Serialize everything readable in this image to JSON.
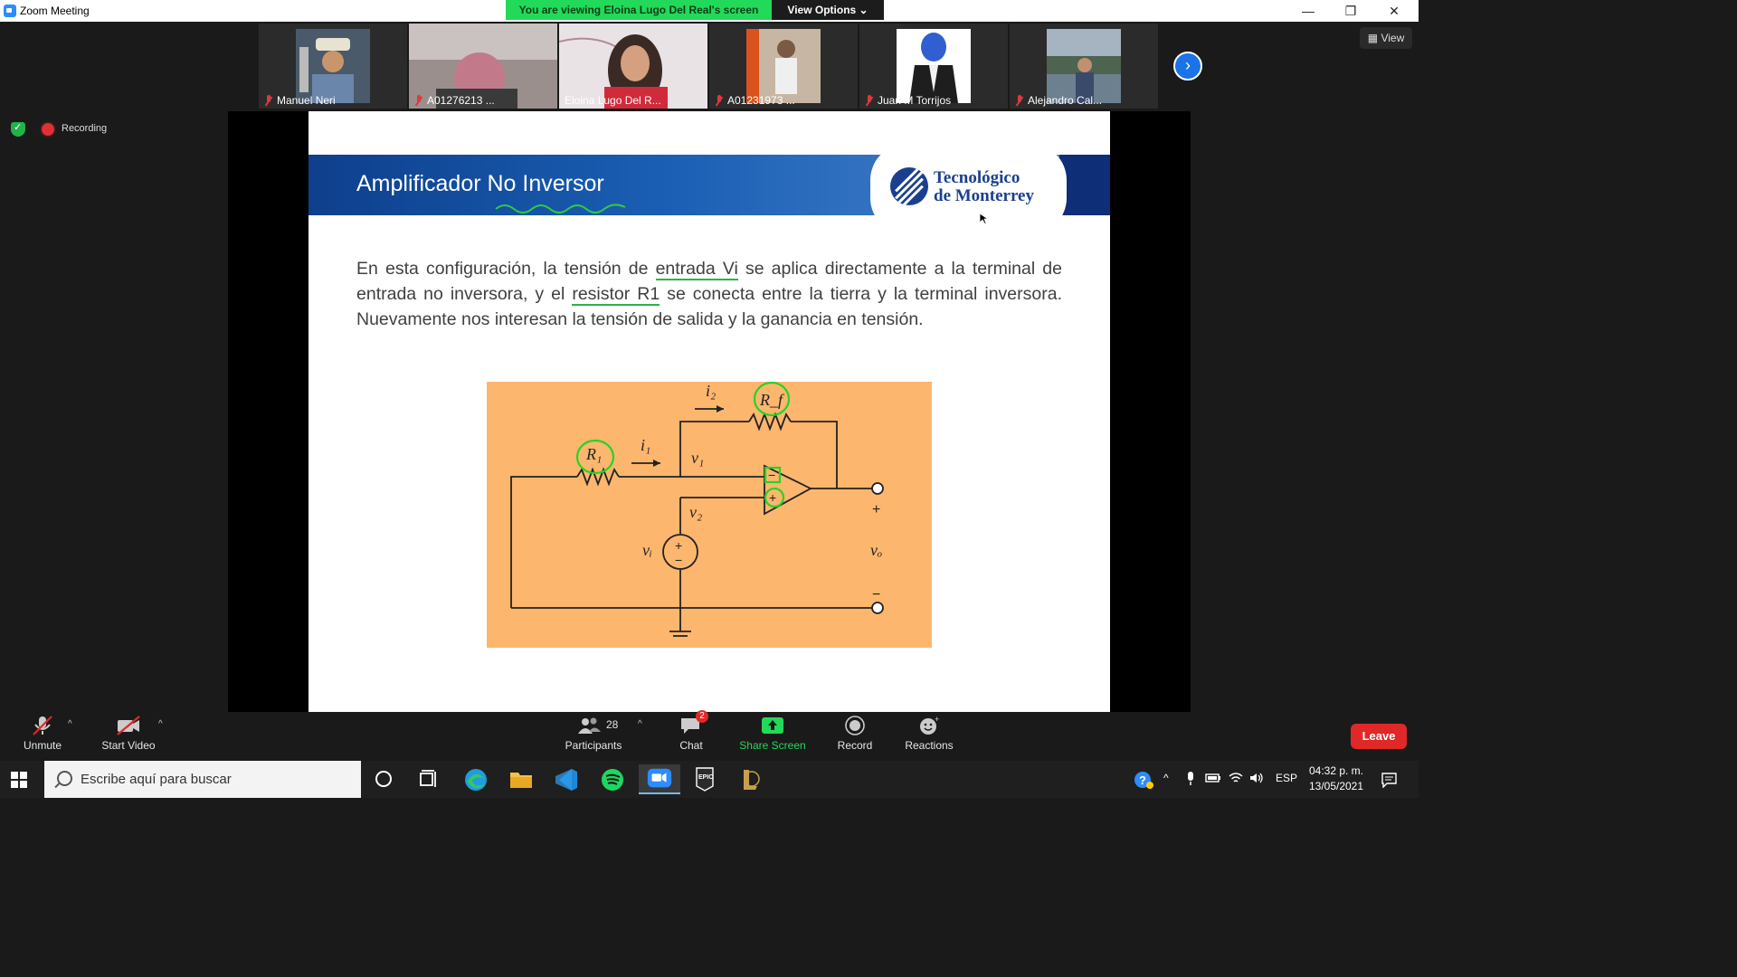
{
  "window": {
    "title": "Zoom Meeting"
  },
  "banner": {
    "viewing": "You are viewing Eloina Lugo Del Real's screen",
    "view_options": "View Options ⌄"
  },
  "window_controls": {
    "minimize": "—",
    "restore": "❐",
    "close": "✕"
  },
  "participants_strip": [
    {
      "name": "Manuel Neri",
      "muted": true
    },
    {
      "name": "A01276213 ...",
      "muted": true
    },
    {
      "name": "Eloina Lugo Del R...",
      "muted": false
    },
    {
      "name": "A01231973 ...",
      "muted": true
    },
    {
      "name": "Juan M Torrijos",
      "muted": true
    },
    {
      "name": "Alejandro Cal...",
      "muted": true
    }
  ],
  "view_button": "View",
  "next_button": "›",
  "recording": {
    "label": "Recording"
  },
  "slide": {
    "title": "Amplificador No Inversor",
    "logo_line1": "Tecnológico",
    "logo_line2": "de Monterrey",
    "body_1": "En esta configuración, la tensión de ",
    "body_u1": "entrada Vi",
    "body_2": " se aplica directamente a la terminal de entrada no inversora, y el ",
    "body_u2": "resistor R1",
    "body_3": " se conecta entre la tierra y la terminal inversora. Nuevamente nos interesan la tensión de salida y la ganancia en tensión.",
    "circuit_labels": {
      "i2": "i₂",
      "Rf": "R_f",
      "R1": "R₁",
      "i1": "i₁",
      "v1": "v₁",
      "v2": "v₂",
      "vi": "vᵢ",
      "vo": "vₒ",
      "plus": "+",
      "minus": "−"
    }
  },
  "toolbar": {
    "unmute": "Unmute",
    "start_video": "Start Video",
    "participants": "Participants",
    "participants_count": "28",
    "chat": "Chat",
    "chat_badge": "2",
    "share_screen": "Share Screen",
    "record": "Record",
    "reactions": "Reactions",
    "leave": "Leave"
  },
  "taskbar": {
    "search_placeholder": "Escribe aquí para buscar",
    "language": "ESP",
    "time": "04:32 p. m.",
    "date": "13/05/2021"
  },
  "colors": {
    "accent_green": "#23d959",
    "zoom_blue": "#2D8CFF",
    "leave_red": "#e02828",
    "slide_orange": "#fdb66d"
  }
}
